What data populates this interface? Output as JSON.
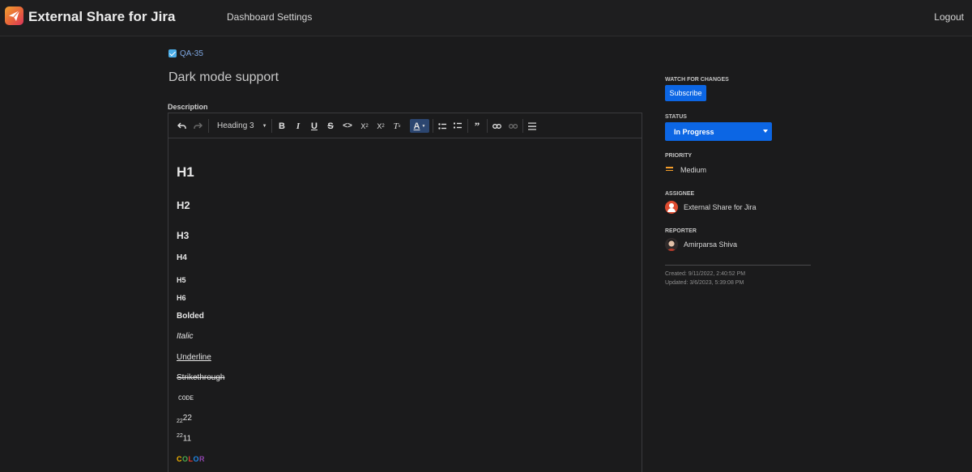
{
  "header": {
    "app_title": "External Share for Jira",
    "nav": {
      "dashboard": "Dashboard",
      "settings": "Settings"
    },
    "logout": "Logout"
  },
  "issue": {
    "key": "QA-35",
    "title": "Dark mode support",
    "description_label": "Description"
  },
  "editor": {
    "heading_select": "Heading 3",
    "toolbar_icons": [
      "undo-icon",
      "redo-icon",
      "bold-icon",
      "italic-icon",
      "underline-icon",
      "strikethrough-icon",
      "code-icon",
      "subscript-icon",
      "superscript-icon",
      "clear-format-icon",
      "text-color-icon",
      "bullet-list-icon",
      "numbered-list-icon",
      "quote-icon",
      "link-icon",
      "unlink-icon",
      "horizontal-rule-icon"
    ],
    "content": {
      "h1": "H1",
      "h2": "H2",
      "h3": "H3",
      "h4": "H4",
      "h5": "H5",
      "h6": "H6",
      "bolded": "Bolded",
      "italic": "Italic",
      "underline": "Underline",
      "strikethrough": "Strikethrough",
      "code": "CODE",
      "subscript_base": "22",
      "subscript_text": "22",
      "superscript_base": "11",
      "superscript_text": "22",
      "color_letters": [
        "C",
        "O",
        "L",
        "O",
        "R"
      ],
      "color_colors": [
        "#f5b400",
        "#4caf50",
        "#e53935",
        "#1e88e5",
        "#8e44ad"
      ]
    }
  },
  "sidebar": {
    "watch": {
      "label": "WATCH FOR CHANGES",
      "button": "Subscribe"
    },
    "status": {
      "label": "STATUS",
      "value": "In Progress"
    },
    "priority": {
      "label": "PRIORITY",
      "value": "Medium",
      "color": "#f59e2a"
    },
    "assignee": {
      "label": "ASSIGNEE",
      "value": "External Share for Jira"
    },
    "reporter": {
      "label": "REPORTER",
      "value": "Amirparsa Shiva"
    },
    "created": "Created: 9/11/2022, 2:40:52 PM",
    "updated": "Updated: 3/6/2023, 5:39:08 PM"
  },
  "colors": {
    "accent": "#0c66e4",
    "background": "#1b1b1c"
  }
}
